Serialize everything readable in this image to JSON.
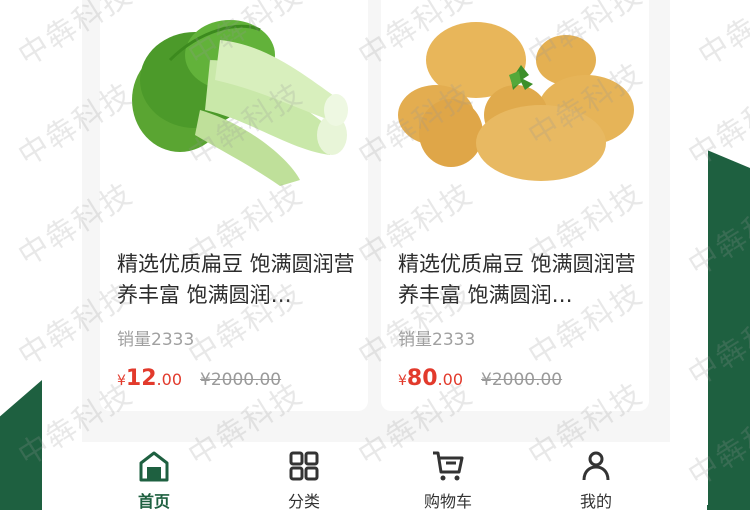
{
  "products": [
    {
      "title": "精选优质扁豆 饱满圆润营养丰富 饱满圆润…",
      "sales": "销量2333",
      "price_symbol": "¥",
      "price_int": "12",
      "price_dec": ".00",
      "old_price": "¥2000.00",
      "image": "bok-choy"
    },
    {
      "title": "精选优质扁豆 饱满圆润营养丰富 饱满圆润…",
      "sales": "销量2333",
      "price_symbol": "¥",
      "price_int": "80",
      "price_dec": ".00",
      "old_price": "¥2000.00",
      "image": "potatoes"
    }
  ],
  "tabbar": {
    "items": [
      {
        "label": "首页",
        "icon": "home-icon",
        "active": true
      },
      {
        "label": "分类",
        "icon": "category-icon",
        "active": false
      },
      {
        "label": "购物车",
        "icon": "cart-icon",
        "active": false
      },
      {
        "label": "我的",
        "icon": "user-icon",
        "active": false
      }
    ]
  },
  "watermark": "中犇科技",
  "colors": {
    "brand": "#1e6040",
    "price": "#e23a2c"
  }
}
